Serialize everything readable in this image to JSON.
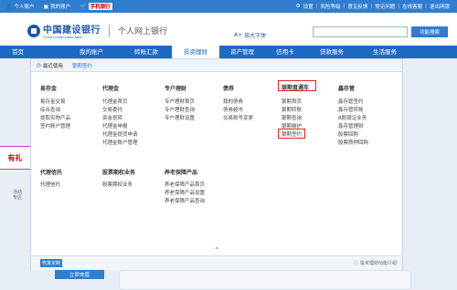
{
  "topbar": {
    "personal_account": "个人账户",
    "my_account": "我的账户",
    "promo": "手机银行",
    "right_links": [
      "设置",
      "风险等级",
      "意见反馈",
      "常见问题",
      "在线客服",
      "退出网银"
    ]
  },
  "header": {
    "logo_cn": "中国建设银行",
    "logo_en": "China Construction Bank",
    "subtitle": "个人网上银行",
    "zoom_label": "放大字体",
    "search_button": "功能搜索"
  },
  "nav": {
    "items": [
      "首页",
      "我的账户",
      "转账汇款",
      "投资理财",
      "资产管理",
      "信用卡",
      "贷款服务",
      "生活服务"
    ],
    "active_index": 3
  },
  "crumb": {
    "label": "最近使用",
    "value": "银期签约"
  },
  "columns": {
    "col1": {
      "title": "易存金",
      "items": [
        "易存金交易",
        "综合查询",
        "提取实物产品",
        "签约账户管理"
      ]
    },
    "col2": {
      "title": "代理金",
      "items": [
        "代理金首页",
        "交易委托",
        "资金划转",
        "代理金申报",
        "代理金提货申请",
        "代理金账户管理"
      ]
    },
    "col3": {
      "title": "专户理财",
      "items": [
        "专户理财首页",
        "专户理财查询",
        "专户理财设置"
      ]
    },
    "col4": {
      "title": "债券",
      "items": [
        "我的债券",
        "债券超市",
        "交易账号变更"
      ]
    },
    "col5": {
      "title": "银期直通车",
      "items": [
        "银期首页",
        "银期转账",
        "银期查询",
        "银期维护",
        "银期签约"
      ]
    },
    "col6": {
      "title": "鑫存管",
      "items": [
        "鑫存管签约",
        "鑫存管转账",
        "B股银证业务",
        "鑫存管理财",
        "股票回购",
        "股票质押回购"
      ]
    },
    "col7": {
      "title": "代理信托",
      "items": [
        "代理信托"
      ]
    },
    "col8": {
      "title": "股票期权业务",
      "items": [
        "股票期权业务"
      ]
    },
    "col9": {
      "title": "养老保障产品",
      "items": [
        "养老保障产品首页",
        "养老保障产品设置",
        "养老保障产品查询"
      ]
    }
  },
  "footer": {
    "button": "恢复定制",
    "help": "投资理财功能介绍"
  },
  "background": {
    "ad_text": "有礼",
    "left_note": [
      "活动",
      "专区"
    ],
    "bottom_button": "立即充值"
  }
}
